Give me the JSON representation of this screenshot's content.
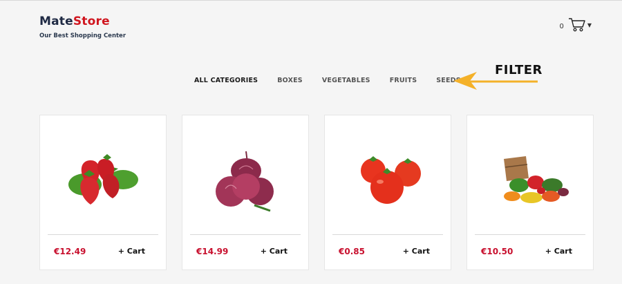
{
  "brand": {
    "name_part1": "Mate",
    "name_part2": "Store",
    "tagline": "Our Best Shopping Center"
  },
  "cart": {
    "count": "0",
    "icon": "shopping-cart-icon"
  },
  "filters": [
    {
      "label": "ALL CATEGORIES",
      "active": true
    },
    {
      "label": "BOXES",
      "active": false
    },
    {
      "label": "VEGETABLES",
      "active": false
    },
    {
      "label": "FRUITS",
      "active": false
    },
    {
      "label": "SEEDS",
      "active": false
    }
  ],
  "annotation": {
    "label": "FILTER",
    "arrow_color": "#f4b129"
  },
  "products": [
    {
      "image": "strawberries-image",
      "price": "€12.49",
      "cart_label": "+ Cart"
    },
    {
      "image": "red-onions-image",
      "price": "€14.99",
      "cart_label": "+ Cart"
    },
    {
      "image": "tomatoes-image",
      "price": "€0.85",
      "cart_label": "+ Cart"
    },
    {
      "image": "vegetable-basket-image",
      "price": "€10.50",
      "cart_label": "+ Cart"
    }
  ],
  "colors": {
    "brand_dark": "#1f2a44",
    "brand_red": "#d0161f",
    "price": "#c8102e",
    "background": "#f5f5f5"
  }
}
